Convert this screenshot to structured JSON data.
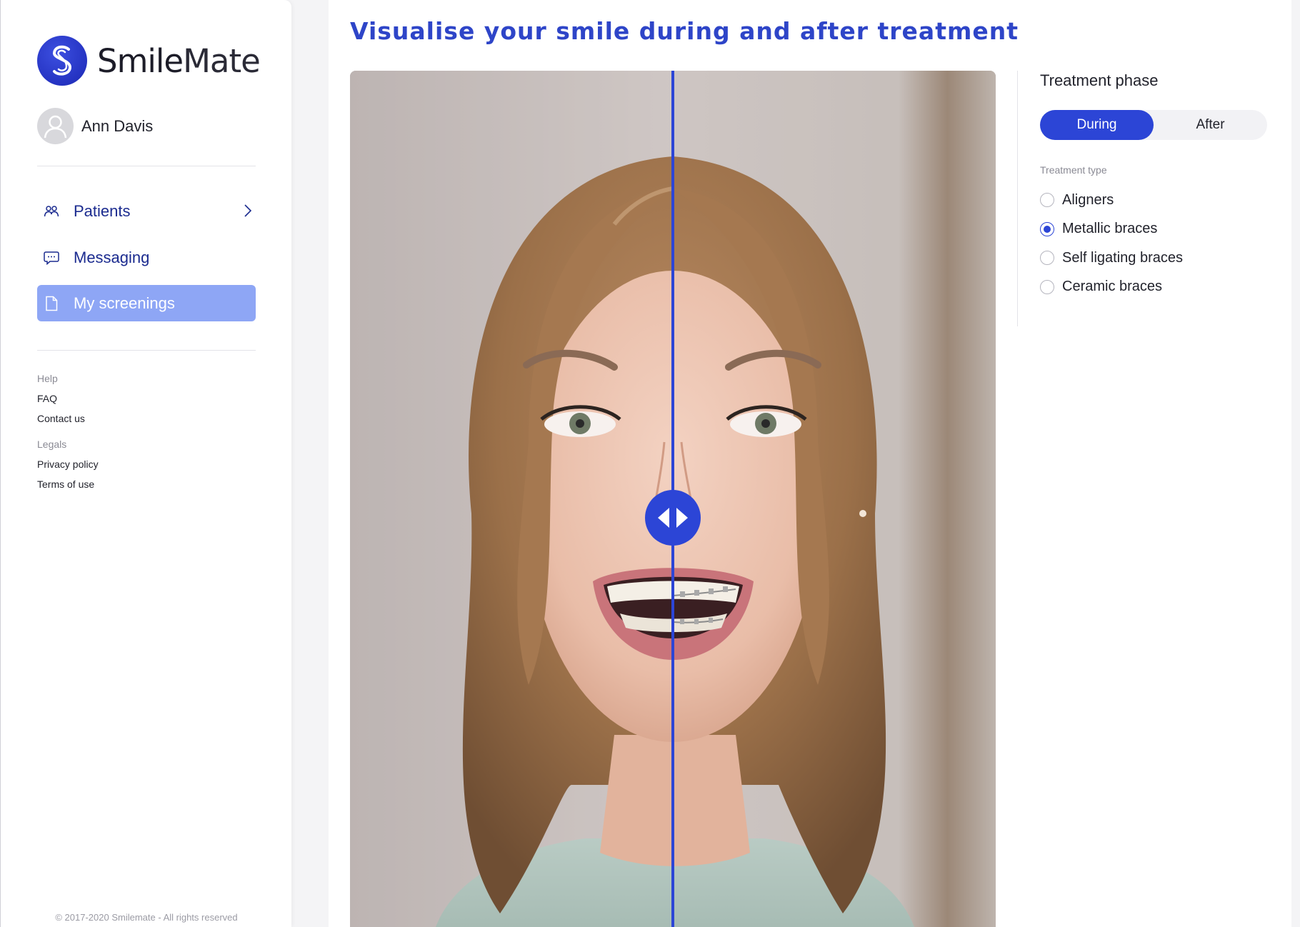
{
  "brand": {
    "name_part1": "Smile",
    "name_part2": "Mate",
    "logo_icon": "smilemate-s-logo-icon",
    "accent_color": "#2c45d6"
  },
  "user": {
    "name": "Ann Davis",
    "avatar_icon": "user-silhouette-icon"
  },
  "nav": {
    "items": [
      {
        "label": "Patients",
        "icon": "patients-icon",
        "has_chevron": true,
        "active": false
      },
      {
        "label": "Messaging",
        "icon": "chat-bubble-icon",
        "has_chevron": false,
        "active": false
      },
      {
        "label": "My screenings",
        "icon": "document-icon",
        "has_chevron": false,
        "active": true
      }
    ]
  },
  "footer_links": {
    "help_title": "Help",
    "faq": "FAQ",
    "contact": "Contact us",
    "legals_title": "Legals",
    "privacy": "Privacy policy",
    "terms": "Terms of use"
  },
  "copyright": "© 2017-2020 Smilemate - All rights reserved",
  "main": {
    "title": "Visualise your smile during and after treatment",
    "comparison_position": 0.5
  },
  "panel": {
    "title": "Treatment phase",
    "phases": [
      {
        "label": "During",
        "selected": true
      },
      {
        "label": "After",
        "selected": false
      }
    ],
    "type_label": "Treatment type",
    "types": [
      {
        "label": "Aligners",
        "checked": false
      },
      {
        "label": "Metallic braces",
        "checked": true
      },
      {
        "label": "Self ligating braces",
        "checked": false
      },
      {
        "label": "Ceramic braces",
        "checked": false
      }
    ]
  }
}
